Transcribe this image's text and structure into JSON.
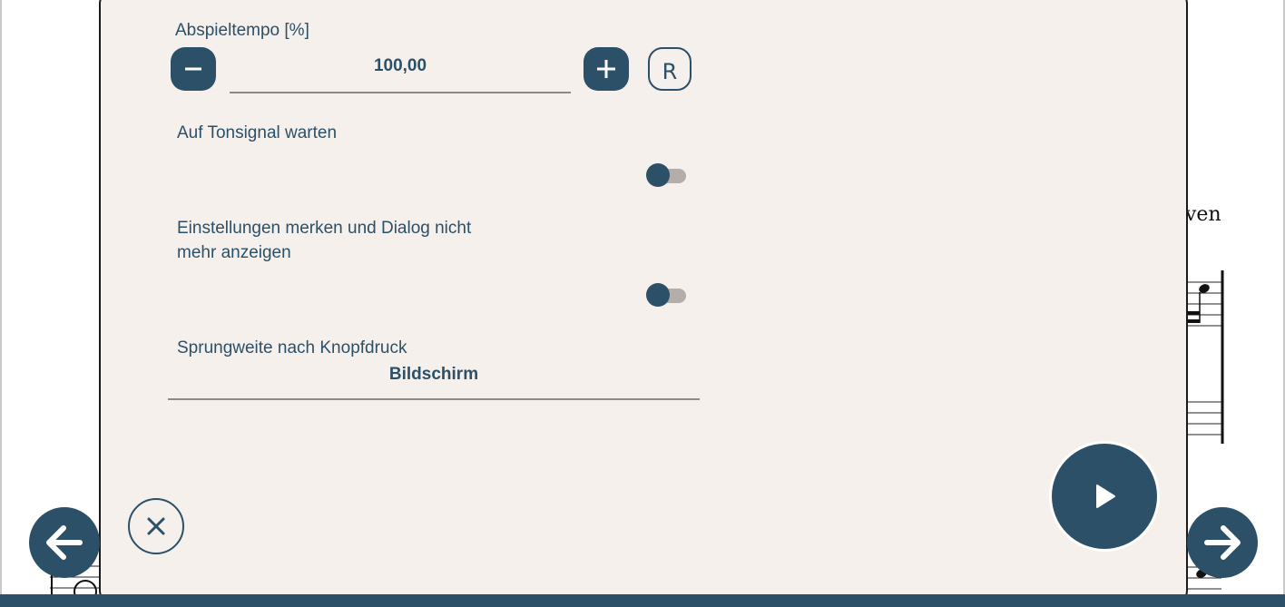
{
  "background": {
    "composer_fragment": "ven"
  },
  "dialog": {
    "tempo": {
      "label": "Abspieltempo [%]",
      "value": "100,00",
      "decrease_icon": "minus-icon",
      "increase_icon": "plus-icon",
      "reset_label": "R"
    },
    "wait_for_tone": {
      "label": "Auf Tonsignal warten",
      "enabled": false
    },
    "remember_settings": {
      "label_line1": "Einstellungen merken und Dialog nicht",
      "label_line2": "mehr anzeigen",
      "enabled": false
    },
    "jump_width": {
      "label": "Sprungweite nach Knopfdruck",
      "value": "Bildschirm"
    }
  },
  "colors": {
    "accent": "#2b5068",
    "panel": "#f6f0ec",
    "toggle_track": "#b4aeab"
  },
  "icons": {
    "close": "close-icon",
    "play": "play-icon",
    "prev": "arrow-left-icon",
    "next": "arrow-right-icon"
  }
}
